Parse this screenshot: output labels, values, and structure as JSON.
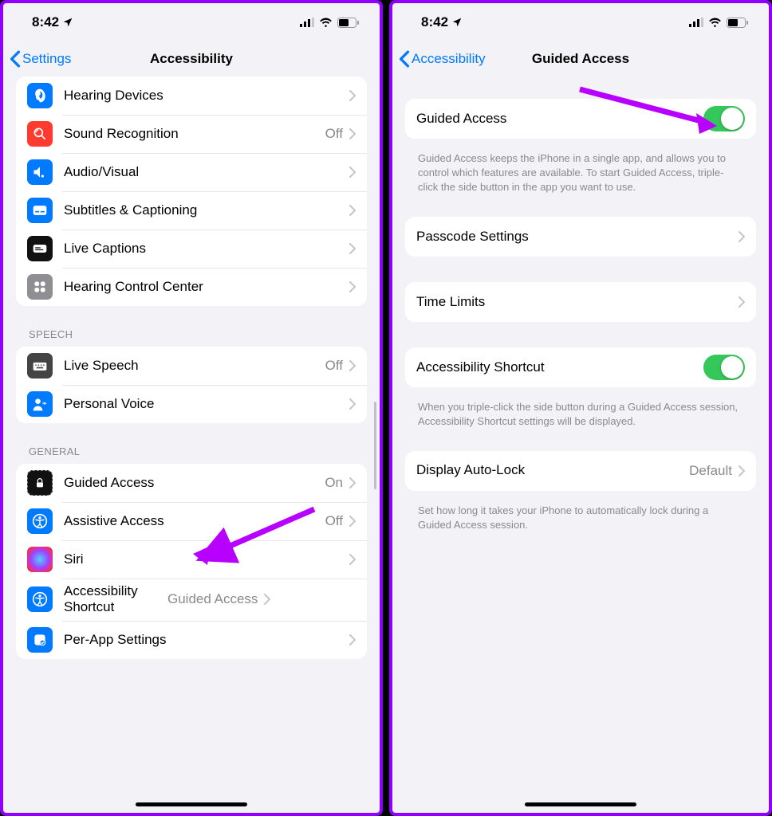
{
  "status": {
    "time": "8:42",
    "location_icon": "▸"
  },
  "left": {
    "back": "Settings",
    "title": "Accessibility",
    "groups": [
      {
        "header": null,
        "rows": [
          {
            "icon": "ear",
            "bg": "#007aff",
            "label": "Hearing Devices",
            "detail": ""
          },
          {
            "icon": "sound",
            "bg": "#ff3b30",
            "label": "Sound Recognition",
            "detail": "Off"
          },
          {
            "icon": "av",
            "bg": "#007aff",
            "label": "Audio/Visual",
            "detail": ""
          },
          {
            "icon": "cc",
            "bg": "#007aff",
            "label": "Subtitles & Captioning",
            "detail": ""
          },
          {
            "icon": "live",
            "bg": "#111",
            "label": "Live Captions",
            "detail": ""
          },
          {
            "icon": "hearctrl",
            "bg": "#8e8e93",
            "label": "Hearing Control Center",
            "detail": ""
          }
        ]
      },
      {
        "header": "SPEECH",
        "rows": [
          {
            "icon": "keyboard",
            "bg": "#444",
            "label": "Live Speech",
            "detail": "Off"
          },
          {
            "icon": "voice",
            "bg": "#007aff",
            "label": "Personal Voice",
            "detail": ""
          }
        ]
      },
      {
        "header": "GENERAL",
        "rows": [
          {
            "icon": "lock",
            "bg": "#111",
            "outline": true,
            "label": "Guided Access",
            "detail": "On"
          },
          {
            "icon": "access",
            "bg": "#007aff",
            "label": "Assistive Access",
            "detail": "Off"
          },
          {
            "icon": "siri",
            "bg": "#000",
            "label": "Siri",
            "detail": ""
          },
          {
            "icon": "access",
            "bg": "#007aff",
            "label": "Accessibility Shortcut",
            "detail": "Guided Access",
            "two": true
          },
          {
            "icon": "perapp",
            "bg": "#007aff",
            "label": "Per-App Settings",
            "detail": ""
          }
        ]
      }
    ]
  },
  "right": {
    "back": "Accessibility",
    "title": "Guided Access",
    "rows": {
      "guided": {
        "label": "Guided Access",
        "on": true
      },
      "guided_footer": "Guided Access keeps the iPhone in a single app, and allows you to control which features are available. To start Guided Access, triple-click the side button in the app you want to use.",
      "passcode": {
        "label": "Passcode Settings"
      },
      "timelimits": {
        "label": "Time Limits"
      },
      "shortcut": {
        "label": "Accessibility Shortcut",
        "on": true
      },
      "shortcut_footer": "When you triple-click the side button during a Guided Access session, Accessibility Shortcut settings will be displayed.",
      "autolock": {
        "label": "Display Auto-Lock",
        "detail": "Default"
      },
      "autolock_footer": "Set how long it takes your iPhone to automatically lock during a Guided Access session."
    }
  }
}
